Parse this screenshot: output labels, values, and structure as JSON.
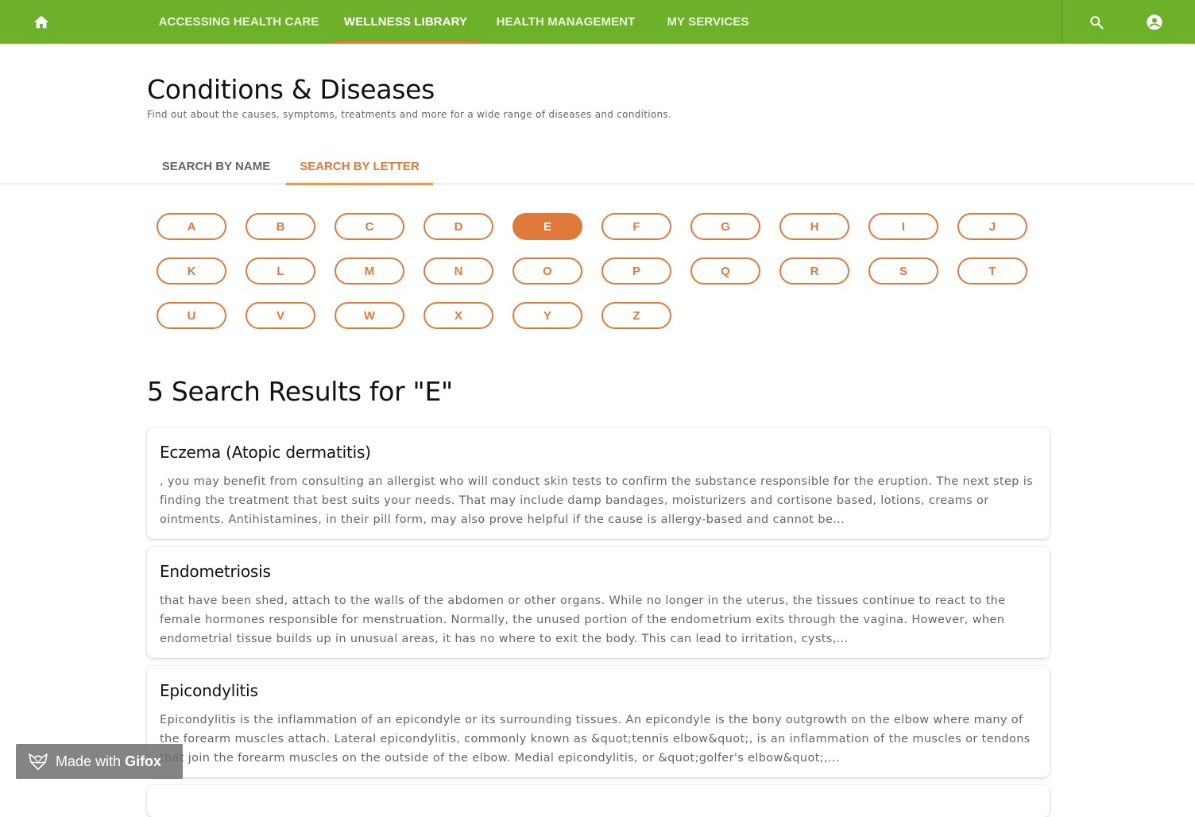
{
  "nav": {
    "home_icon": "home-icon",
    "items": [
      {
        "label": "ACCESSING HEALTH CARE"
      },
      {
        "label": "WELLNESS LIBRARY",
        "active": true
      },
      {
        "label": "HEALTH MANAGEMENT"
      },
      {
        "label": "MY SERVICES"
      }
    ],
    "search_icon": "search-icon",
    "account_icon": "account-circle-icon",
    "bar_color": "#6db12a",
    "accent_color": "#e07a3c"
  },
  "page": {
    "title": "Conditions & Diseases",
    "subtitle": "Find out about the causes, symptoms, treatments and more for a wide range of diseases and conditions."
  },
  "tabs": [
    {
      "label": "SEARCH BY NAME",
      "active": false
    },
    {
      "label": "SEARCH BY LETTER",
      "active": true
    }
  ],
  "letters": [
    "A",
    "B",
    "C",
    "D",
    "E",
    "F",
    "G",
    "H",
    "I",
    "J",
    "K",
    "L",
    "M",
    "N",
    "O",
    "P",
    "Q",
    "R",
    "S",
    "T",
    "U",
    "V",
    "W",
    "X",
    "Y",
    "Z"
  ],
  "selected_letter": "E",
  "results": {
    "heading": "5 Search Results for \"E\"",
    "items": [
      {
        "title": "Eczema (Atopic dermatitis)",
        "excerpt": ", you may benefit from consulting an allergist who will conduct skin tests to confirm the substance responsible for the eruption. The next step is finding the treatment that best suits your needs. That may include damp bandages, moisturizers and cortisone based, lotions, creams or ointments. Antihistamines, in their pill form, may also prove helpful if the cause is allergy-based and cannot be..."
      },
      {
        "title": "Endometriosis",
        "excerpt": "that have been shed, attach to the walls of the abdomen or other organs. While no longer in the uterus, the tissues continue to react to the female hormones responsible for menstruation. Normally, the unused portion of the endometrium exits through the vagina. However, when endometrial tissue builds up in unusual areas, it has no where to exit the body. This can lead to irritation, cysts,..."
      },
      {
        "title": "Epicondylitis",
        "excerpt": "Epicondylitis is the inflammation of an epicondyle or its surrounding tissues. An epicondyle is the bony outgrowth on the elbow where many of the forearm muscles attach. Lateral epicondylitis, commonly known as &quot;tennis elbow&quot;, is an inflammation of the muscles or tendons that join the forearm muscles on the outside of the elbow. Medial epicondylitis, or &quot;golfer's elbow&quot;,..."
      }
    ]
  },
  "watermark": {
    "prefix": "Made with",
    "brand": "Gifox",
    "icon": "fox-logo-icon"
  }
}
